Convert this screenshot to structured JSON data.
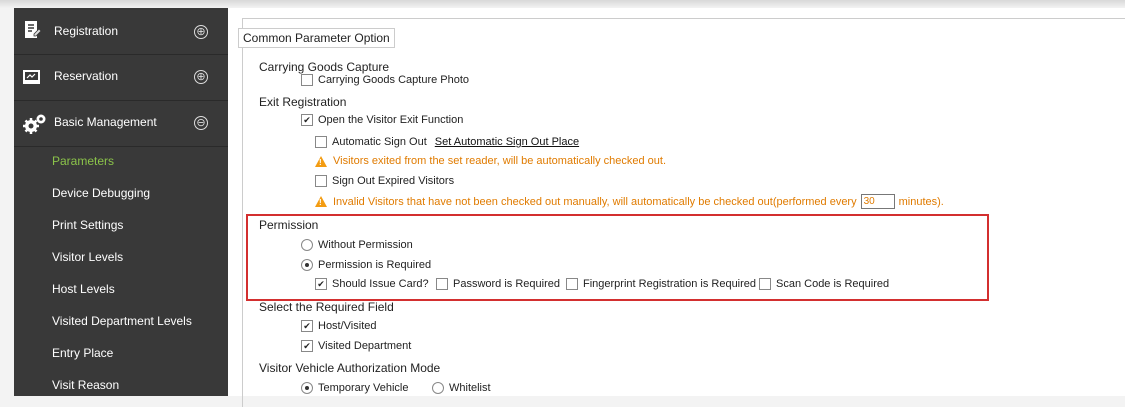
{
  "sidebar": {
    "headers": [
      {
        "label": "Registration",
        "icon": "registration-icon",
        "toggle": "⊕"
      },
      {
        "label": "Reservation",
        "icon": "reservation-icon",
        "toggle": "⊕"
      },
      {
        "label": "Basic Management",
        "icon": "gears-icon",
        "toggle": "⊖"
      }
    ],
    "items": [
      {
        "label": "Parameters",
        "active": true
      },
      {
        "label": "Device Debugging"
      },
      {
        "label": "Print Settings"
      },
      {
        "label": "Visitor Levels"
      },
      {
        "label": "Host Levels"
      },
      {
        "label": "Visited Department Levels"
      },
      {
        "label": "Entry Place"
      },
      {
        "label": "Visit Reason"
      }
    ]
  },
  "main": {
    "legend": "Common Parameter Option",
    "carrying": {
      "title": "Carrying Goods Capture",
      "option": "Carrying Goods Capture Photo",
      "checked": false
    },
    "exit": {
      "title": "Exit Registration",
      "open_label": "Open the Visitor Exit Function",
      "auto_signout": "Automatic Sign Out",
      "auto_link": "Set Automatic Sign Out Place",
      "warn1": "Visitors exited from the set reader, will be automatically checked out.",
      "expired": "Sign Out Expired Visitors",
      "warn2": "Invalid Visitors that have not been checked out manually, will automatically be checked out(performed every",
      "minutes_value": "30",
      "minutes_label": "minutes)."
    },
    "permission": {
      "title": "Permission",
      "without": "Without Permission",
      "required": "Permission is Required",
      "issue_card": "Should Issue Card?",
      "password": "Password is Required",
      "fingerprint": "Fingerprint Registration is Required",
      "scan_code": "Scan Code is Required"
    },
    "required_field": {
      "title": "Select the Required Field",
      "host": "Host/Visited",
      "dept": "Visited Department"
    },
    "vehicle": {
      "title": "Visitor Vehicle Authorization Mode",
      "temporary": "Temporary Vehicle",
      "whitelist": "Whitelist"
    }
  },
  "colors": {
    "sidebar_bg": "#393939",
    "active": "#8bc34a",
    "warning": "#e07b00",
    "highlight_box": "#d32f2f"
  }
}
